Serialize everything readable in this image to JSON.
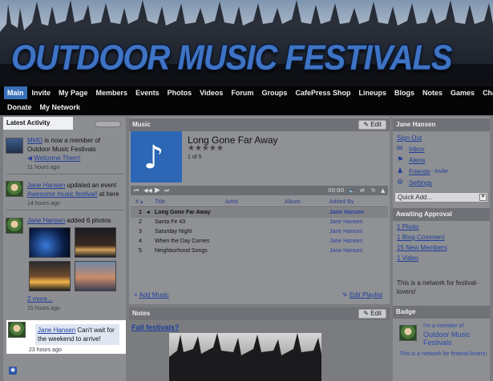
{
  "header": {
    "title": "OUTDOOR MUSIC FESTIVALS"
  },
  "nav": {
    "row1": [
      "Main",
      "Invite",
      "My Page",
      "Members",
      "Events",
      "Photos",
      "Videos",
      "Forum",
      "Groups",
      "CafePress Shop",
      "Lineups",
      "Blogs",
      "Notes",
      "Games",
      "Chat"
    ],
    "row2": [
      "Donate",
      "My Network"
    ],
    "active": "Main"
  },
  "latest_activity": {
    "title": "Latest Activity",
    "items": [
      {
        "user": "MMD",
        "text": " is now a member of Outdoor Music Festivals",
        "link": "Welcome Them!",
        "time": "11 hours ago"
      },
      {
        "user": "Jane Hansen",
        "text": " updated an event",
        "link": "Awesome music festival!",
        "link_suffix": " at here",
        "time": "14 hours ago"
      },
      {
        "user": "Jane Hansen",
        "text": " added 6 photos",
        "more": "2 more...",
        "time": "15 hours ago"
      },
      {
        "user": "Jane Hansen",
        "text": " Can't wait for the weekend to arrive!",
        "time": "23 hours ago"
      }
    ]
  },
  "music": {
    "title": "Music",
    "edit_label": "Edit",
    "track_title": "Long Gone Far Away",
    "rating": "★★★★★",
    "count": "1 of 5",
    "time": "00:00",
    "columns": {
      "num": "#",
      "title": "Title",
      "artist": "Artist",
      "album": "Album",
      "added_by": "Added By"
    },
    "tracks": [
      {
        "num": "1",
        "title": "Long Gone Far Away",
        "added_by": "Jane Hansen"
      },
      {
        "num": "2",
        "title": "Santa Fe 43",
        "added_by": "Jane Hansen"
      },
      {
        "num": "3",
        "title": "Saturday Night",
        "added_by": "Jane Hansen"
      },
      {
        "num": "4",
        "title": "When the Day Comes",
        "added_by": "Jane Hansen"
      },
      {
        "num": "5",
        "title": "Neighborhood Songs",
        "added_by": "Jane Hansen"
      }
    ],
    "add_music": "Add Music",
    "edit_playlist": "Edit Playlist"
  },
  "notes": {
    "title": "Notes",
    "edit_label": "Edit",
    "post_title": "Fall festivals?"
  },
  "user_panel": {
    "name": "Jane Hansen",
    "sign_out": "Sign Out",
    "inbox": "Inbox",
    "alerts": "Alerts",
    "friends": "Friends",
    "invite": "- Invite",
    "settings": "Settings",
    "quick_add": "Quick Add..."
  },
  "approval": {
    "title": "Awaiting Approval",
    "items": [
      "1 Photo",
      "1 Blog Comment",
      "15 New Members",
      "1 Video"
    ],
    "network_text": "This is a network for festival-lovers!"
  },
  "badge": {
    "title": "Badge",
    "member_of": "I'm a member of",
    "network_name": "Outdoor Music Festivals",
    "network_text": "This is a network for festival-lovers!"
  },
  "colors": {
    "accent": "#3a6fb7",
    "link": "#1f3e9a",
    "nav_bg": "#050505"
  }
}
